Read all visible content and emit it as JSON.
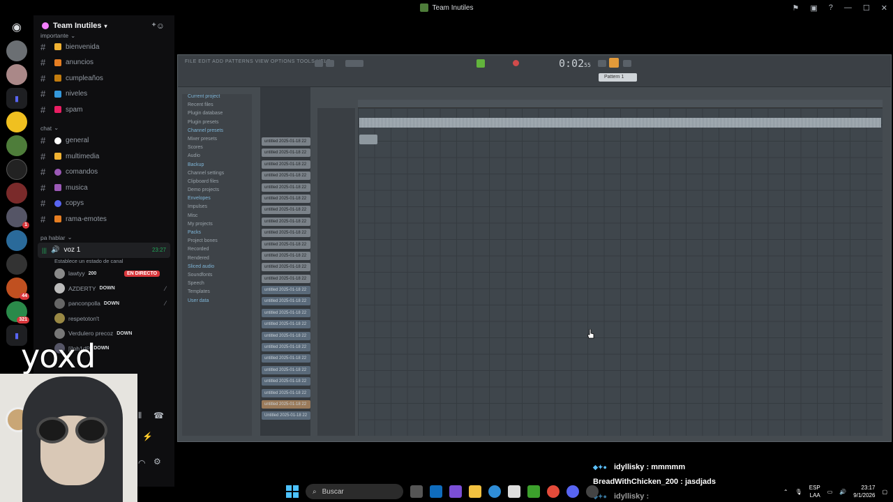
{
  "window": {
    "title": "Team Inutiles"
  },
  "guild": {
    "name": "Team Inutiles"
  },
  "categories": [
    {
      "name": "importante",
      "channels": [
        {
          "name": "bienvenida",
          "emoji_color": "#f0b232"
        },
        {
          "name": "anuncios",
          "emoji_color": "#e67e22"
        },
        {
          "name": "cumpleaños",
          "emoji_color": "#c27c0e"
        },
        {
          "name": "niveles",
          "emoji_color": "#3498db"
        },
        {
          "name": "spam",
          "emoji_color": "#e91e63"
        }
      ]
    },
    {
      "name": "chat",
      "channels": [
        {
          "name": "general",
          "emoji_color": "#ffffff"
        },
        {
          "name": "multimedia",
          "emoji_color": "#f0b232"
        },
        {
          "name": "comandos",
          "emoji_color": "#9b59b6"
        },
        {
          "name": "musica",
          "emoji_color": "#9b59b6"
        },
        {
          "name": "copys",
          "emoji_color": "#5865f2"
        },
        {
          "name": "rama-emotes",
          "emoji_color": "#e67e22"
        }
      ]
    },
    {
      "name": "pa hablar"
    }
  ],
  "voice": {
    "channel": "voz 1",
    "time": "23:27",
    "status": "Establece un estado de canal",
    "live_label": "EN DIRECTO",
    "users": [
      {
        "name": "lawtyy",
        "tag": "200",
        "live": true
      },
      {
        "name": "AZDERTY",
        "tag": "DOWN"
      },
      {
        "name": "panconpolla",
        "tag": "DOWN"
      },
      {
        "name": "respetoton't",
        "tag": ""
      },
      {
        "name": "Verdulero precoz",
        "tag": "DOWN"
      },
      {
        "name": "[i]nh1dP",
        "tag": "DOWN"
      }
    ]
  },
  "overlay_text": "yoxd",
  "fl": {
    "time": "0:02",
    "time_small": "55",
    "pattern": "Pattern 1",
    "browser": [
      "Current project",
      "Recent files",
      "Plugin database",
      "Plugin presets",
      "Channel presets",
      "Mixer presets",
      "Scores",
      "Audio",
      "Backup",
      "Channel settings",
      "Clipboard files",
      "Demo projects",
      "Envelopes",
      "Impulses",
      "Misc",
      "My projects",
      "Packs",
      "Project bones",
      "Recorded",
      "Rendered",
      "Sliced audio",
      "Soundfonts",
      "Speech",
      "Templates",
      "User data"
    ],
    "clips": [
      "untitled 2025-01-18 22",
      "untitled 2025-01-18 22",
      "untitled 2025-01-18 22",
      "untitled 2025-01-18 22",
      "untitled 2025-01-18 22",
      "untitled 2025-01-18 22",
      "untitled 2025-01-18 22",
      "untitled 2025-01-18 22",
      "untitled 2025-01-18 22",
      "untitled 2025-01-18 22",
      "untitled 2025-01-18 22",
      "untitled 2025-01-18 22",
      "untitled 2025-01-18 22",
      "untitled 2025-01-18 22",
      "untitled 2025-01-18 22",
      "untitled 2025-01-18 22",
      "untitled 2025-01-18 22",
      "untitled 2025-01-18 22",
      "untitled 2025-01-18 22",
      "untitled 2025-01-18 22",
      "untitled 2025-01-18 22",
      "untitled 2025-01-18 22",
      "untitled 2025-01-18 22",
      "untitled 2025-01-18 22",
      "Untitled 2025-01-18 22"
    ]
  },
  "chat": [
    {
      "user": "idyllisky",
      "text": "mmmmm"
    },
    {
      "user": "BreadWithChicken_200",
      "text": "jasdjads"
    },
    {
      "user": "idyllisky",
      "text": ""
    }
  ],
  "taskbar": {
    "search_placeholder": "Buscar",
    "lang_top": "ESP",
    "lang_bottom": "LAA",
    "time": "23:17",
    "date": "9/1/2026"
  }
}
